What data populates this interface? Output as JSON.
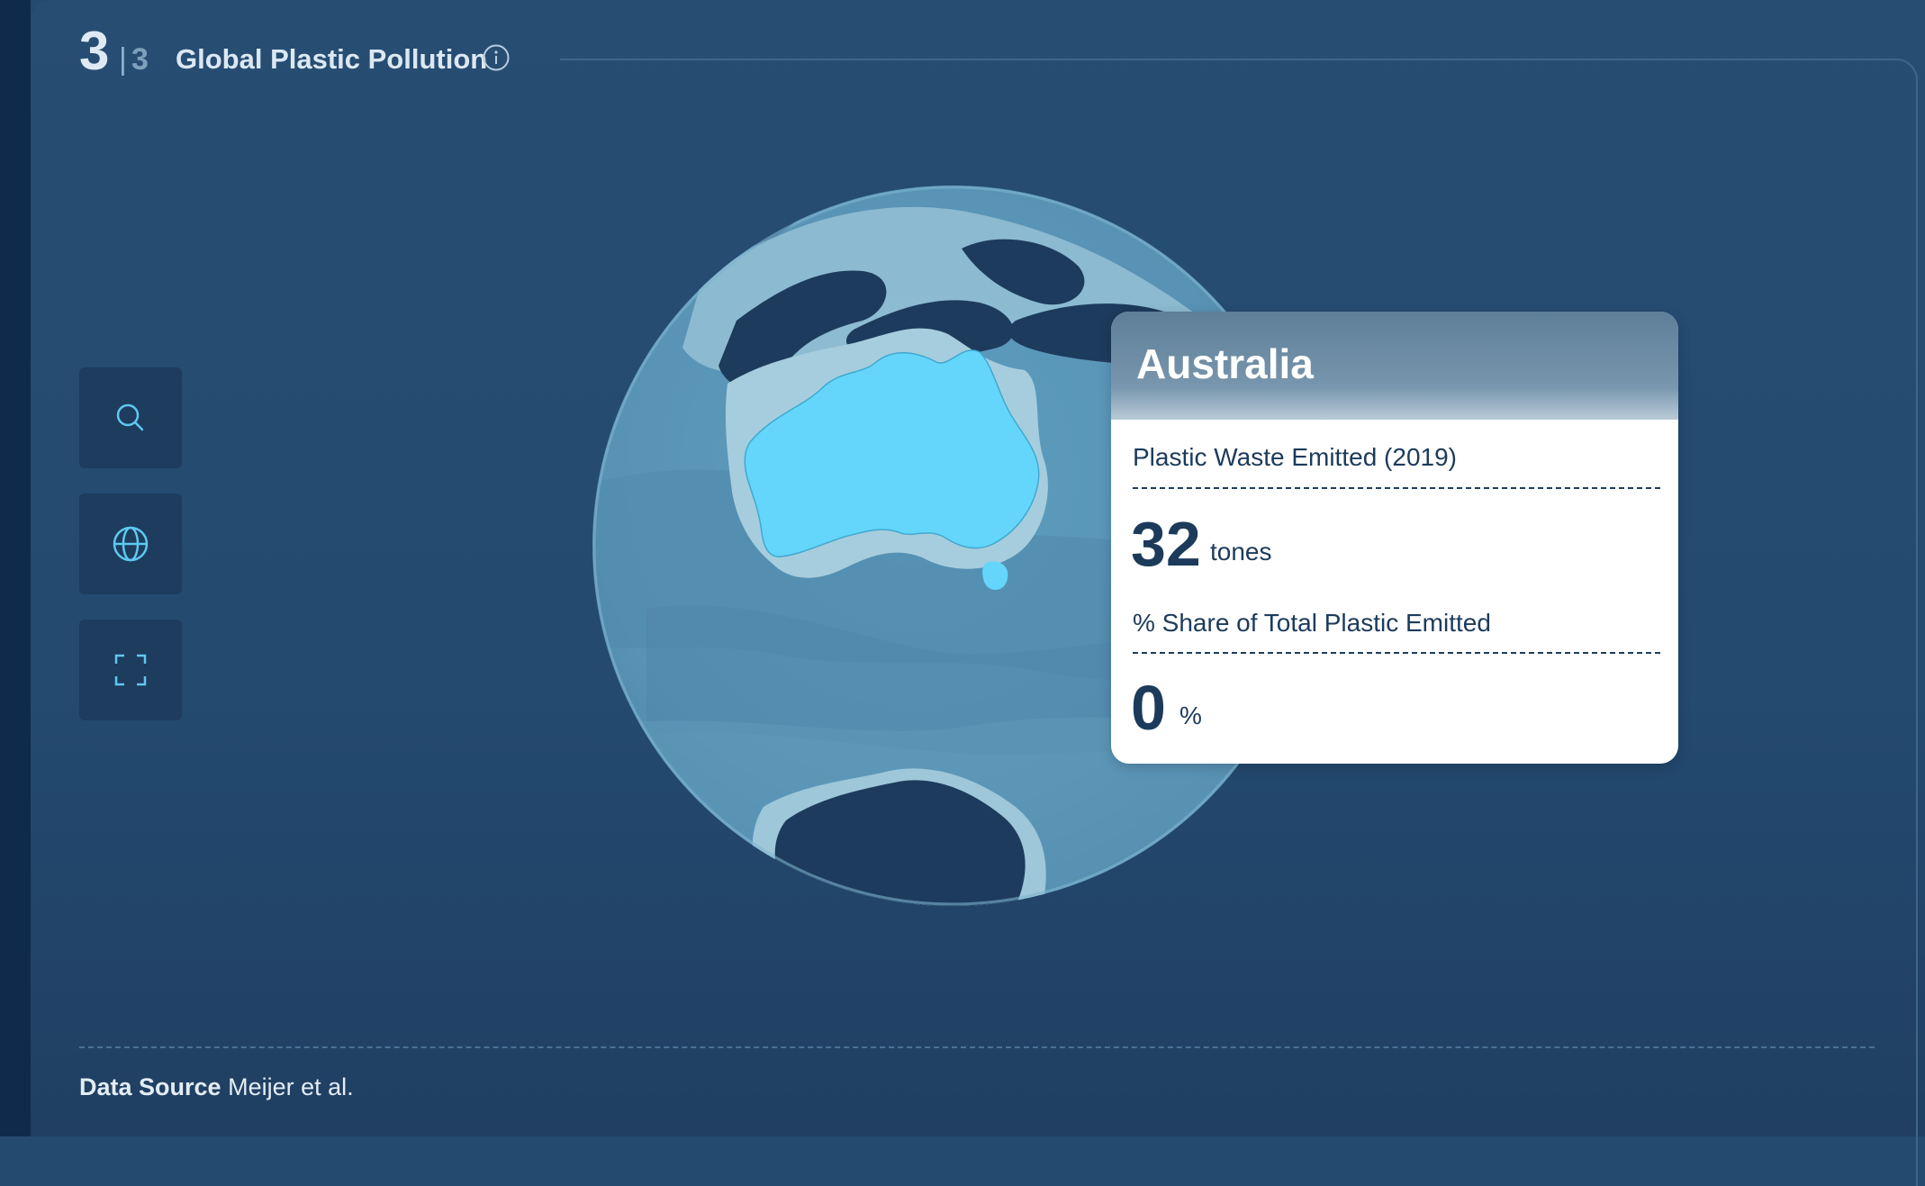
{
  "header": {
    "current_step": "3",
    "separator": "|",
    "total_steps": "3",
    "title": "Global Plastic Pollution",
    "info_icon": "info-circle-icon"
  },
  "controls": [
    {
      "name": "search-button",
      "icon": "search-icon"
    },
    {
      "name": "globe-button",
      "icon": "globe-icon"
    },
    {
      "name": "fullscreen-button",
      "icon": "fullscreen-icon"
    }
  ],
  "map": {
    "highlighted_region": "Australia",
    "colors": {
      "ocean": "#5b9bbd",
      "land": "#1d3b5c",
      "highlight": "#64d6fb",
      "shelf": "#a6cddd"
    }
  },
  "tooltip": {
    "country": "Australia",
    "metric1_label": "Plastic Waste Emitted (2019)",
    "metric1_value": "32",
    "metric1_unit": "tones",
    "metric2_label": "% Share of Total Plastic Emitted",
    "metric2_value": "0",
    "metric2_unit": "%"
  },
  "footer": {
    "label": "Data Source",
    "source": "Meijer et al."
  },
  "colors": {
    "background": "#254a6f",
    "accent": "#5ec8ef",
    "text_light": "#dbe8f3"
  }
}
